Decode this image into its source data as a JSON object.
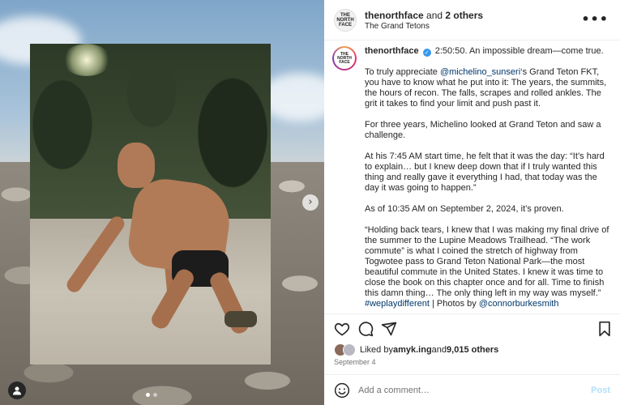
{
  "post": {
    "header": {
      "author": "thenorthface",
      "coauthors_text": " and ",
      "coauthors_count": "2 others",
      "location": "The Grand Tetons",
      "avatar_text": "THE NORTH FACE"
    },
    "caption": {
      "username": "thenorthface",
      "verified_glyph": "✓",
      "paragraphs": [
        "2:50:50. An impossible dream—come true.",
        "To truly appreciate ",
        "‘s Grand Teton FKT, you have to know what he put into it: The years, the summits, the hours of recon. The falls, scrapes and rolled ankles. The grit it takes to find your limit and push past it.",
        "For three years, Michelino looked at Grand Teton and saw a challenge.",
        "At his 7:45 AM start time, he felt that it was the day: “It’s hard to explain… but I knew deep down that if I truly wanted this thing and really gave it everything I had, that today was the day it was going to happen.”",
        "As of 10:35 AM on September 2, 2024, it’s proven.",
        "“Holding back tears, I knew that I was making my final drive of the summer to the Lupine Meadows Trailhead. “The work commute” is what I coined the stretch of highway from Togwotee pass to Grand Teton National Park—the most beautiful commute in the United States. I knew it was time to close the book on this chapter once and for all. Time to finish this damn thing… The only thing left in my way was myself.”"
      ],
      "mention": "@michelino_sunseri",
      "hashtag": "#weplaydifferent",
      "photos_by": " | Photos by ",
      "photographer": "@connorburkesmith"
    },
    "likes": {
      "prefix": "Liked by ",
      "user": "amyk.ing",
      "middle": " and ",
      "count": "9,015 others"
    },
    "date": "September 4",
    "comment_input": {
      "placeholder": "Add a comment…",
      "post_label": "Post"
    },
    "more_glyph": "•••"
  },
  "media": {
    "next_glyph": "›",
    "tag_glyph": "👤",
    "carousel_count": 2,
    "carousel_active": 1
  },
  "icons": [
    "heart-icon",
    "comment-icon",
    "share-icon",
    "bookmark-icon",
    "emoji-icon",
    "user-tag-icon",
    "chevron-right-icon"
  ],
  "colors": {
    "link": "#00376b",
    "verified": "#3897f0",
    "post_disabled": "#b2dffc",
    "muted_text": "#737373"
  }
}
